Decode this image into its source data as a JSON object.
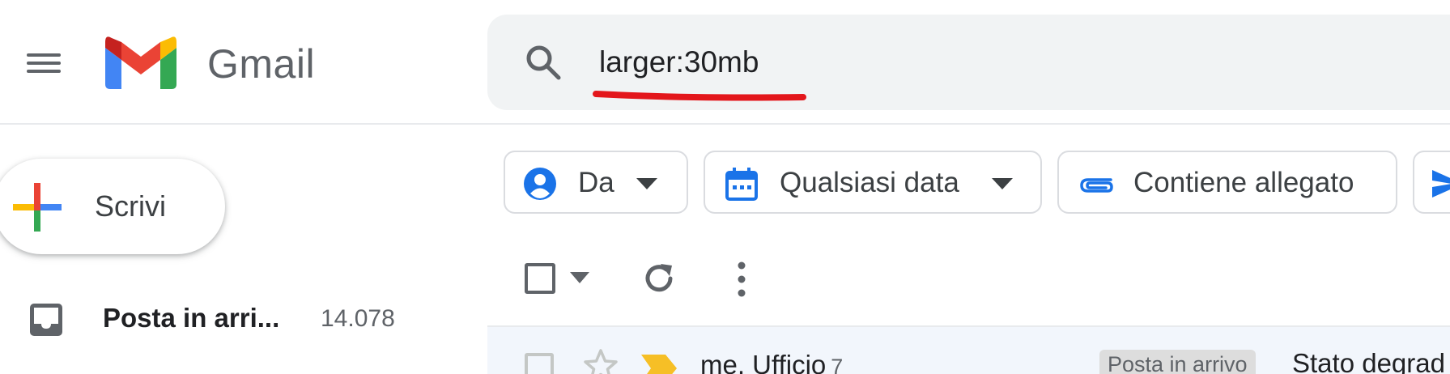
{
  "app": {
    "name": "Gmail",
    "colors": {
      "red": "#ea4335",
      "blue": "#4285f4",
      "yellow": "#fbbc04",
      "green": "#34a853",
      "underline": "#e3161b"
    }
  },
  "header": {
    "menu_icon": "hamburger-menu-icon",
    "logo_icon": "gmail-m-logo",
    "logo_text": "Gmail"
  },
  "search": {
    "icon": "search-icon",
    "query": "larger:30mb"
  },
  "compose": {
    "icon": "plus-icon",
    "label": "Scrivi"
  },
  "sidebar": {
    "items": [
      {
        "icon": "inbox-icon",
        "label": "Posta in arri...",
        "count": "14.078"
      }
    ]
  },
  "filters": [
    {
      "icon": "person-icon",
      "label": "Da",
      "has_caret": true
    },
    {
      "icon": "calendar-icon",
      "label": "Qualsiasi data",
      "has_caret": true
    },
    {
      "icon": "attachment-icon",
      "label": "Contiene allegato",
      "has_caret": false
    },
    {
      "icon": "send-icon",
      "label": "",
      "has_caret": false
    }
  ],
  "toolbar": {
    "select_icon": "checkbox-icon",
    "select_caret_icon": "caret-down-icon",
    "refresh_icon": "refresh-icon",
    "more_icon": "more-vert-icon"
  },
  "email_rows": [
    {
      "sender": "me, Ufficio",
      "thread_count": "7",
      "label": "Posta in arrivo",
      "subject": "Stato degrad"
    }
  ]
}
